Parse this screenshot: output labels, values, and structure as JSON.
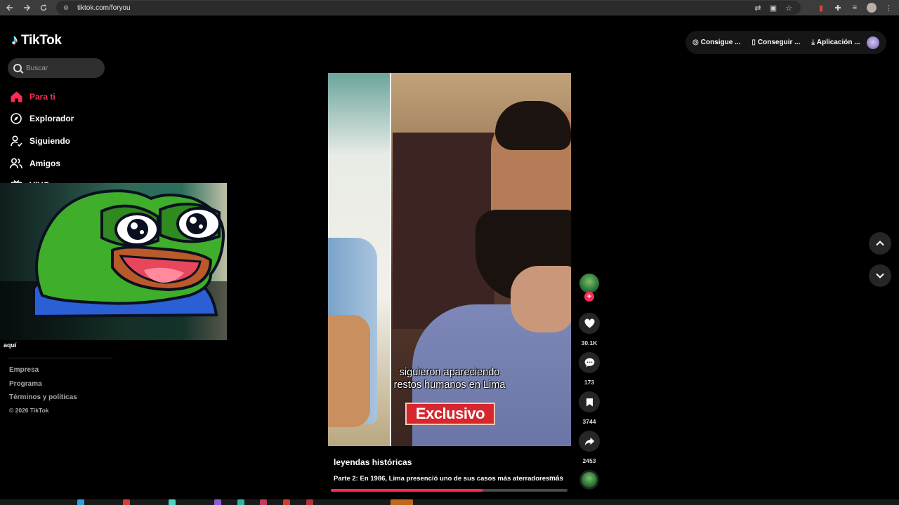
{
  "browser": {
    "url": "tiktok.com/foryou",
    "back_icon": "arrow-left-icon",
    "forward_icon": "arrow-right-icon",
    "reload_icon": "reload-icon"
  },
  "brand": {
    "logo_text": "TikTok"
  },
  "search": {
    "placeholder": "Buscar"
  },
  "sidebar": {
    "items": [
      {
        "label": "Para ti",
        "icon": "home-icon",
        "active": true
      },
      {
        "label": "Explorador",
        "icon": "compass-icon",
        "active": false
      },
      {
        "label": "Siguiendo",
        "icon": "following-icon",
        "active": false
      },
      {
        "label": "Amigos",
        "icon": "friends-icon",
        "active": false
      },
      {
        "label": "VIVO",
        "icon": "live-icon",
        "active": false
      }
    ],
    "overlay_caption": "aquí",
    "footer_links": [
      "Empresa",
      "Programa",
      "Términos y políticas"
    ],
    "copyright": "© 2026 TikTok"
  },
  "top_actions": {
    "coins_label": "Consigue ...",
    "app_label": "Conseguir ...",
    "download_label": "Aplicación ..."
  },
  "video": {
    "subtitle_line1": "siguieron apareciendo",
    "subtitle_line2": "restos humanos en Lima",
    "banner": "Exclusivo",
    "author": "leyendas históricas",
    "description": "Parte 2: En 1986, Lima presenció uno de sus casos más aterradores:",
    "more_label": "más",
    "progress": 0.64
  },
  "actions": {
    "likes": "30.1K",
    "comments": "173",
    "saves": "3744",
    "shares": "2453"
  },
  "colors": {
    "accent": "#fe2c55",
    "background": "#000000",
    "pepe_green": "#3fae2a",
    "pepe_shirt": "#2b5fd6"
  }
}
